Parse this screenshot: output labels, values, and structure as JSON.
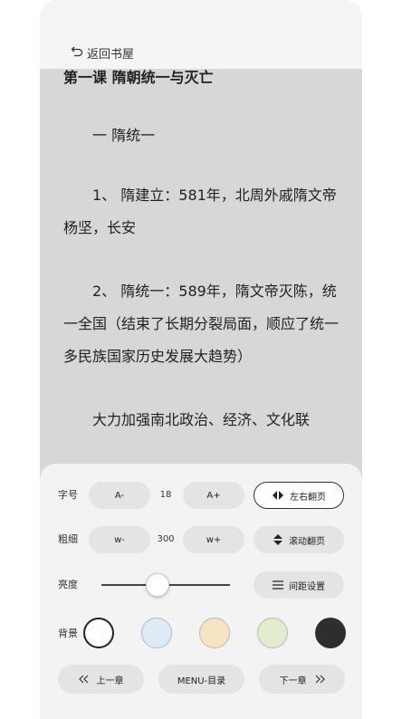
{
  "header": {
    "back_label": "返回书屋"
  },
  "content": {
    "chapter_title": "第一课 隋朝统一与灭亡",
    "paragraphs": [
      "　　一 隋统一",
      "　　1、 隋建立：581年，北周外戚隋文帝杨坚，长安",
      "　　2、 隋统一：589年，隋文帝灭陈，统一全国（结束了长期分裂局面，顺应了统一多民族国家历史发展大趋势）",
      "　　大力加强南北政治、经济、文化联"
    ]
  },
  "settings": {
    "font_size": {
      "label": "字号",
      "minus": "A-",
      "value": "18",
      "plus": "A+"
    },
    "weight": {
      "label": "粗细",
      "minus": "w-",
      "value": "300",
      "plus": "w+"
    },
    "page_mode_lr": "左右翻页",
    "page_mode_scroll": "滚动翻页",
    "brightness": {
      "label": "亮度",
      "level": 0.43
    },
    "spacing_label": "间距设置",
    "background": {
      "label": "背景",
      "colors": [
        "#ffffff",
        "#dcebf5",
        "#f6e4c3",
        "#e3eccf",
        "#2e2e2e"
      ],
      "selected": 0
    },
    "nav": {
      "prev": "上一章",
      "menu": "MENU-目录",
      "next": "下一章"
    }
  }
}
